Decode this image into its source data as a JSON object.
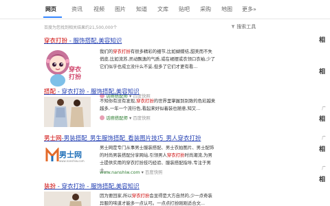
{
  "tabs": [
    "网页",
    "资讯",
    "视频",
    "图片",
    "知道",
    "文库",
    "贴吧",
    "采购",
    "地图",
    "更多»"
  ],
  "active_tab": "网页",
  "stats_text": "百度为您找到相关结果约21,500,000个",
  "search_tools": "搜索工具",
  "search_tools_icon": "funnel-icon",
  "results": [
    {
      "title_hl": "穿衣打扮",
      "title_rest": " - 服饰搭配,美容知识",
      "abstract_pre": "我们的",
      "abstract_hl": "穿衣打扮",
      "abstract_post": "有很多精彩的细节,比如蝴蝶结,甜美而不失俏皮,比如流苏,灵动飘逸的气质,或在裙摆或衣领口衣袖,少了它们似乎也成立没什么不妥,但多了它们才更有看...",
      "site": "话痨搭配师",
      "snapshot": "百度快照",
      "thumb_label": "穿衣打扮"
    },
    {
      "title_hl": "搭配",
      "title_rest": " - 穿衣打扮 - 服饰搭配,美容知识",
      "abstract_pre": "不知你有没有发现,",
      "abstract_hl": "穿衣打扮",
      "abstract_post": "的世界里掌握到别致的色彩越来越多,一年一个流行色,看起来好似着装也随意,知又...",
      "site": "话痨搭配师",
      "snapshot": "百度快照"
    },
    {
      "title_hl": "男士网",
      "title_rest": "-男装搭配_男生服饰搭配_看装图片技巧_男人穿衣打扮",
      "abstract_pre": "男士网是专门从事男士服装搭配、男士衣拍图片、男士配饰的时尚男装搭配分享网站,引领男人",
      "abstract_hl": "穿衣打扮",
      "abstract_post": "时尚潮流,为男士提供实用的穿衣打扮技巧经验、服装搭配指导,专注于男士...",
      "site": "www.nanshiw.com",
      "snapshot": "百度快照",
      "thumb_brand": "男士网",
      "thumb_domain": "www.nanshiw.com"
    },
    {
      "title_hl": "装扮",
      "title_rest": " - 穿衣打扮 - 服饰搭配,美容知识",
      "abstract_pre": "因为要回家,所以",
      "abstract_hl": "穿衣打扮",
      "abstract_post": "会显得是大方自然的,少一点奇装异服的味道才能多一点认可。一点点打扮刚刚适合文...",
      "site": "",
      "snapshot": ""
    }
  ],
  "right_edge_glyphs": [
    "相",
    "相",
    "相",
    "相",
    "相"
  ],
  "ad_marks": [
    "广",
    "广",
    "广"
  ],
  "colors": {
    "accent": "#3385ff",
    "title": "#2440b3",
    "highlight": "#cc0000",
    "site": "#2e7d32"
  }
}
